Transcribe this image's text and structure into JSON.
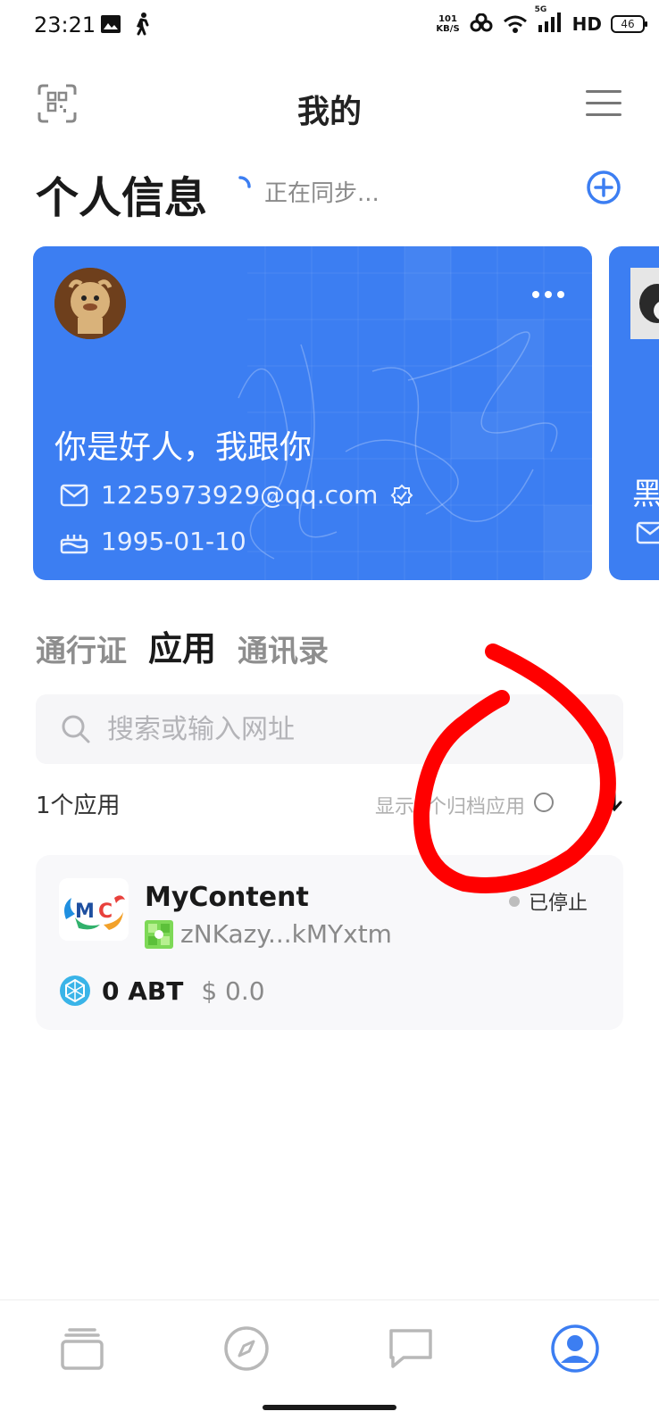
{
  "status_bar": {
    "time": "23:21",
    "net_speed_value": "101",
    "net_speed_unit": "KB/S",
    "network_type": "5G",
    "hd_label": "HD",
    "battery": "46"
  },
  "header": {
    "title": "我的",
    "scan_icon": "scan-icon",
    "menu_icon": "menu-icon"
  },
  "profile_section": {
    "title": "个人信息",
    "sync_text": "正在同步...",
    "add_icon": "plus-circle-icon"
  },
  "card": {
    "name": "你是好人，我跟你",
    "email": "1225973929@qq.com",
    "birthday": "1995-01-10",
    "more_icon": "more-icon",
    "color": "#3c7ef2"
  },
  "card_next": {
    "name_partial": "黑"
  },
  "tabs": [
    {
      "label": "通行证",
      "active": false
    },
    {
      "label": "应用",
      "active": true
    },
    {
      "label": "通讯录",
      "active": false
    }
  ],
  "search": {
    "placeholder": "搜索或输入网址"
  },
  "apps_header": {
    "count_label": "1个应用",
    "archive_label": "显示0个归档应用",
    "sort_icon": "sort-down-icon"
  },
  "apps": [
    {
      "name": "MyContent",
      "did": "zNKazy...kMYxtm",
      "status": "已停止",
      "balance_amount": "0 ABT",
      "balance_usd": "$ 0.0"
    }
  ],
  "bottom_nav": [
    {
      "icon": "wallet-icon",
      "active": false
    },
    {
      "icon": "compass-icon",
      "active": false
    },
    {
      "icon": "chat-icon",
      "active": false
    },
    {
      "icon": "profile-icon",
      "active": true
    }
  ],
  "colors": {
    "accent": "#3c7ef2",
    "annotation": "#ff0000"
  }
}
